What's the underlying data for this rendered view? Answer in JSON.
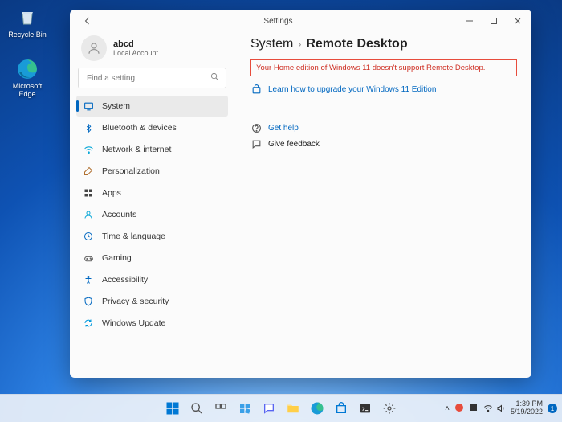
{
  "desktop_icons": {
    "recycle": "Recycle Bin",
    "edge": "Microsoft Edge"
  },
  "window": {
    "app_name": "Settings"
  },
  "account": {
    "name": "abcd",
    "type": "Local Account"
  },
  "search": {
    "placeholder": "Find a setting"
  },
  "nav": [
    {
      "label": "System"
    },
    {
      "label": "Bluetooth & devices"
    },
    {
      "label": "Network & internet"
    },
    {
      "label": "Personalization"
    },
    {
      "label": "Apps"
    },
    {
      "label": "Accounts"
    },
    {
      "label": "Time & language"
    },
    {
      "label": "Gaming"
    },
    {
      "label": "Accessibility"
    },
    {
      "label": "Privacy & security"
    },
    {
      "label": "Windows Update"
    }
  ],
  "main": {
    "crumb_parent": "System",
    "crumb_current": "Remote Desktop",
    "alert": "Your Home edition of Windows 11 doesn't support Remote Desktop.",
    "upgrade_link": "Learn how to upgrade your Windows 11 Edition",
    "get_help": "Get help",
    "give_feedback": "Give feedback"
  },
  "tray": {
    "time": "1:39 PM",
    "date": "5/19/2022",
    "notif_count": "1"
  }
}
